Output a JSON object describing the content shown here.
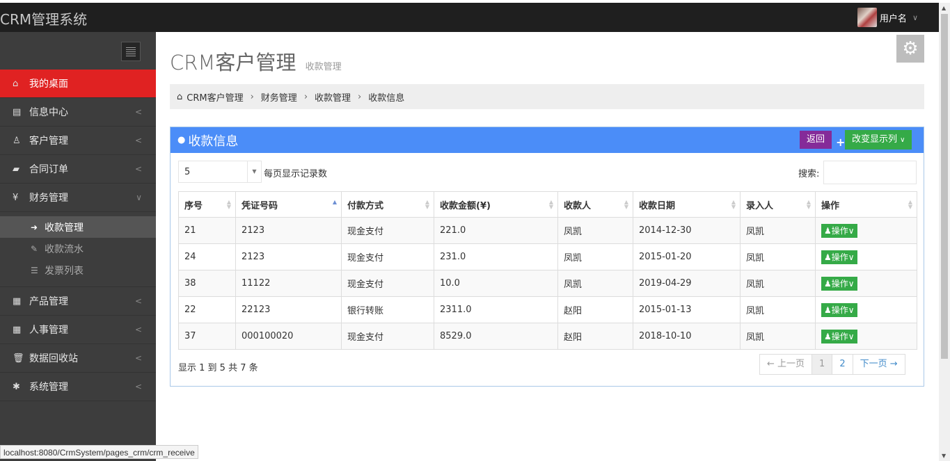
{
  "header": {
    "brand": "CRM管理系统",
    "username": "用户名"
  },
  "sidebar": {
    "items": [
      {
        "icon": "⌂",
        "label": "我的桌面"
      },
      {
        "icon": "▤",
        "label": "信息中心"
      },
      {
        "icon": "♙",
        "label": "客户管理"
      },
      {
        "icon": "▰",
        "label": "合同订单"
      },
      {
        "icon": "¥",
        "label": "财务管理"
      },
      {
        "icon": "▦",
        "label": "产品管理"
      },
      {
        "icon": "▦",
        "label": "人事管理"
      },
      {
        "icon": "🗑",
        "label": "数据回收站"
      },
      {
        "icon": "✱",
        "label": "系统管理"
      }
    ],
    "sub_items": [
      {
        "icon": "➜",
        "label": "收款管理"
      },
      {
        "icon": "✎",
        "label": "收款流水"
      },
      {
        "icon": "☰",
        "label": "发票列表"
      }
    ]
  },
  "page": {
    "title": "CRM客户管理",
    "subtitle": "收款管理"
  },
  "breadcrumb": [
    "CRM客户管理",
    "财务管理",
    "收款管理",
    "收款信息"
  ],
  "portlet": {
    "title": "收款信息",
    "back_label": "返回",
    "columns_label": "改变显示列"
  },
  "table": {
    "page_size": "5",
    "page_size_label": "每页显示记录数",
    "search_label": "搜索:",
    "headers": [
      "序号",
      "凭证号码",
      "付款方式",
      "收款金额(¥)",
      "收款人",
      "收款日期",
      "录入人",
      "操作"
    ],
    "rows": [
      [
        "21",
        "2123",
        "现金支付",
        "221.0",
        "凤凯",
        "2014-12-30",
        "凤凯",
        "操作"
      ],
      [
        "24",
        "2123",
        "现金支付",
        "231.0",
        "凤凯",
        "2015-01-20",
        "凤凯",
        "操作"
      ],
      [
        "38",
        "11122",
        "现金支付",
        "10.0",
        "凤凯",
        "2019-04-29",
        "凤凯",
        "操作"
      ],
      [
        "22",
        "22123",
        "银行转账",
        "2311.0",
        "赵阳",
        "2015-01-13",
        "凤凯",
        "操作"
      ],
      [
        "37",
        "000100020",
        "现金支付",
        "8529.0",
        "赵阳",
        "2018-10-10",
        "凤凯",
        "操作"
      ]
    ],
    "info": "显示 1 到 5 共 7 条",
    "pager": {
      "prev": "← 上一页",
      "pages": [
        "1",
        "2"
      ],
      "next": "下一页 →"
    }
  },
  "statusbar": {
    "url": "localhost:8080/CrmSystem/pages_crm/crm_receive"
  }
}
